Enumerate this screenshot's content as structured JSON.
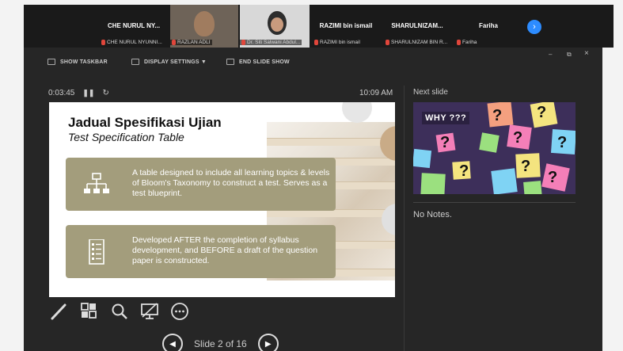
{
  "participants": [
    {
      "name": "CHE NURUL NY...",
      "sub": "CHE NURUL NYUNNI..."
    },
    {
      "name": "",
      "sub": "RAZLAN ADLI"
    },
    {
      "name": "",
      "sub": "Dr. Siti Salwani Abdul..."
    },
    {
      "name": "RAZIMI bin ismail",
      "sub": "RAZIMI bin ismail"
    },
    {
      "name": "SHARULNIZAM...",
      "sub": "SHARULNIZAM BIN R..."
    },
    {
      "name": "Fariha",
      "sub": "Fariha"
    }
  ],
  "toolbar": {
    "show_taskbar": "SHOW TASKBAR",
    "display_settings": "DISPLAY SETTINGS ▼",
    "end_slide_show": "END SLIDE SHOW"
  },
  "window_controls": {
    "minimize": "–",
    "restore": "⧉",
    "close": "×"
  },
  "timer": "0:03:45",
  "clock": "10:09 AM",
  "slide": {
    "title": "Jadual Spesifikasi Ujian",
    "subtitle": "Test Specification Table",
    "card1": "A table designed to include all learning topics & levels of Bloom's Taxonomy to construct a test. Serves as a test blueprint.",
    "card2": "Developed AFTER the completion of syllabus development, and BEFORE a draft of the question paper is constructed."
  },
  "next_slide": {
    "label": "Next slide",
    "heading": "WHY ???"
  },
  "notes": "No Notes.",
  "navigation": {
    "slide_counter": "Slide 2 of 16"
  },
  "colors": {
    "card": "#a39d7c",
    "background": "#262626",
    "accent": "#2d8cff"
  }
}
